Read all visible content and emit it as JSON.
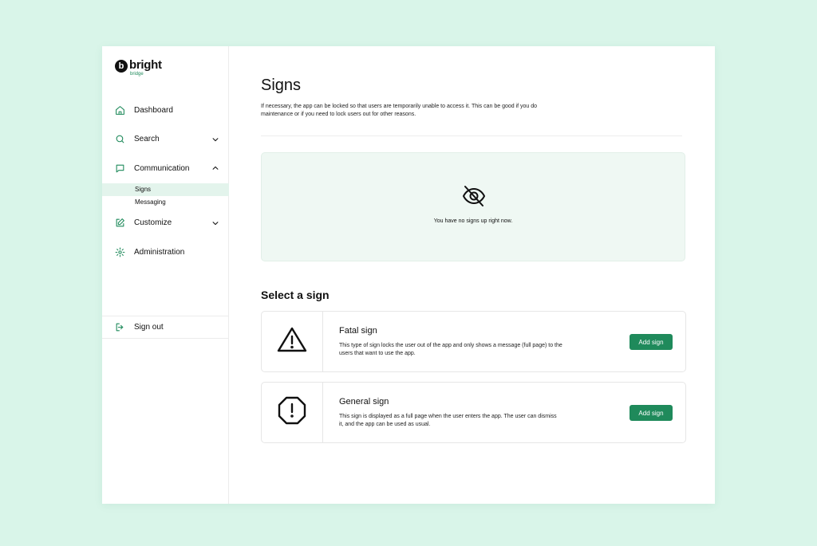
{
  "brand": {
    "mark": "b",
    "name": "bright",
    "sub": "bridge",
    "accent": "#1f8a5b"
  },
  "sidebar": {
    "items": [
      {
        "label": "Dashboard",
        "icon": "home-icon"
      },
      {
        "label": "Search",
        "icon": "search-icon",
        "expandable": true
      },
      {
        "label": "Communication",
        "icon": "chat-icon",
        "expanded": true,
        "children": [
          {
            "label": "Signs",
            "active": true
          },
          {
            "label": "Messaging"
          }
        ]
      },
      {
        "label": "Customize",
        "icon": "edit-icon",
        "expandable": true
      },
      {
        "label": "Administration",
        "icon": "gear-icon"
      }
    ],
    "signout": {
      "label": "Sign out",
      "icon": "sign-out-icon"
    }
  },
  "main": {
    "title": "Signs",
    "description": "If necessary, the app can be locked so that users are temporarily unable to access it. This can be good if you do maintenance or if you need to lock users out for other reasons.",
    "empty_state": {
      "icon": "eye-off-icon",
      "text": "You have no signs up right now."
    },
    "section_title": "Select a sign",
    "cards": [
      {
        "title": "Fatal sign",
        "icon": "warning-triangle-icon",
        "description": "This type of sign locks the user out of the app and only shows a message (full page) to the users that want to use the app.",
        "button": "Add sign"
      },
      {
        "title": "General sign",
        "icon": "alert-octagon-icon",
        "description": "This sign is displayed as a full page when the user enters the app. The user can dismiss it, and the app can be used as usual.",
        "button": "Add sign"
      }
    ]
  }
}
